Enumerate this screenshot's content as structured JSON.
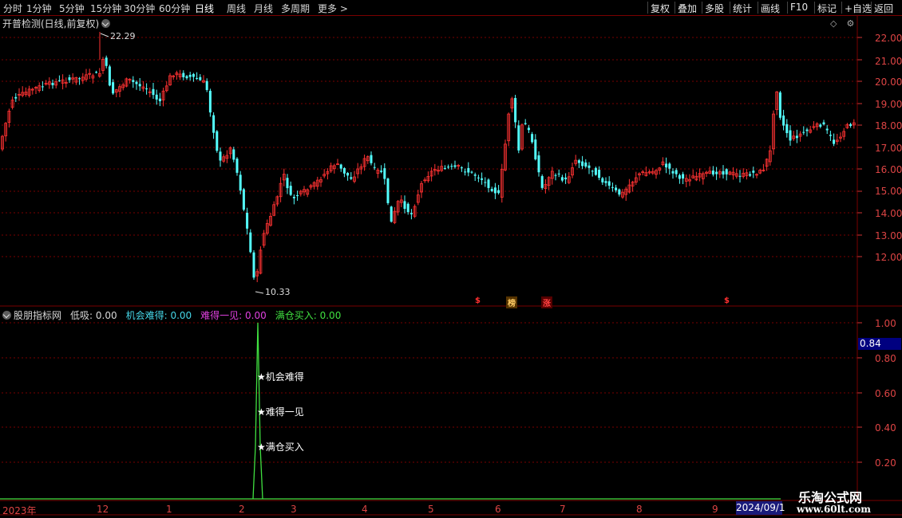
{
  "toolbar": {
    "left": [
      "分时",
      "1分钟",
      "5分钟",
      "15分钟",
      "30分钟",
      "60分钟",
      "日线",
      "周线",
      "月线",
      "多周期",
      "更多 >"
    ],
    "active_index": 6,
    "right": [
      "复权",
      "叠加",
      "多股",
      "统计",
      "画线",
      "F10",
      "标记",
      "+自选",
      "返回"
    ]
  },
  "main_panel": {
    "title": "开普检测(日线,前复权)"
  },
  "price_axis": [
    "22.00",
    "21.00",
    "20.00",
    "19.00",
    "18.00",
    "17.00",
    "16.00",
    "15.00",
    "14.00",
    "13.00",
    "12.00"
  ],
  "extremes": {
    "high": "22.29",
    "low": "10.33"
  },
  "markers": [
    {
      "text": "$",
      "color": "#ff3030"
    },
    {
      "text": "榜",
      "color": "#ffcc66"
    },
    {
      "text": "涨",
      "color": "#ff4040"
    },
    {
      "text": "$",
      "color": "#ff3030"
    }
  ],
  "indicator": {
    "name": "股朋指标网",
    "items": [
      {
        "label": "低吸: 0.00",
        "color": "#d8d8d8"
      },
      {
        "label": "机会难得: 0.00",
        "color": "#46d7e8"
      },
      {
        "label": "难得一见: 0.00",
        "color": "#e040e0"
      },
      {
        "label": "满仓买入: 0.00",
        "color": "#40e040"
      }
    ],
    "axis": [
      "1.00",
      "0.80",
      "0.60",
      "0.40",
      "0.20"
    ],
    "current": "0.84",
    "annotations": [
      "★机会难得",
      "★难得一见",
      "★满仓买入"
    ]
  },
  "date_axis": [
    "2023年",
    "12",
    "1",
    "2",
    "3",
    "4",
    "5",
    "6",
    "7",
    "8",
    "9"
  ],
  "date_current": "2024/09/1",
  "watermark": {
    "line1": "乐淘公式网",
    "line2": "www.60lt.com"
  },
  "colors": {
    "up": "#ff3232",
    "down": "#54ffff",
    "grid": "#7a0000",
    "signal": "#40e040"
  }
}
